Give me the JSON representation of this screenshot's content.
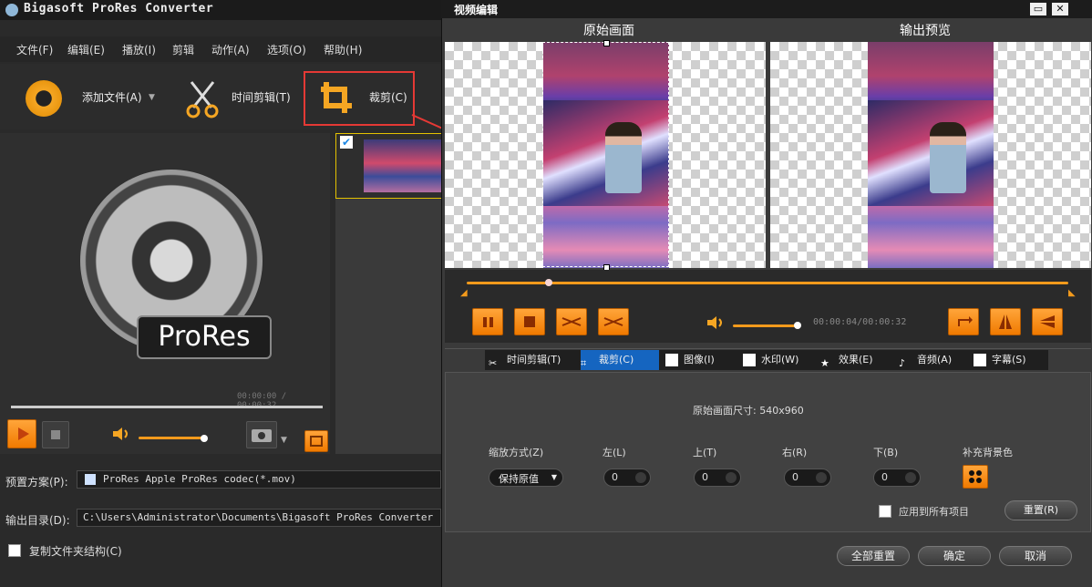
{
  "main_window": {
    "title": "Bigasoft ProRes Converter",
    "menu": [
      "文件(F)",
      "编辑(E)",
      "播放(I)",
      "剪辑",
      "动作(A)",
      "选项(O)",
      "帮助(H)"
    ],
    "toolbar": {
      "add_file": "添加文件(A)",
      "trim": "时间剪辑(T)",
      "crop": "裁剪(C)"
    },
    "logo_text": "ProRes",
    "player_time": "00:00:00 / 00:00:32",
    "preset_label": "预置方案(P):",
    "preset_value": "ProRes Apple ProRes codec(*.mov)",
    "output_label": "输出目录(D):",
    "output_value": "C:\\Users\\Administrator\\Documents\\Bigasoft ProRes Converter",
    "copy_structure_label": "复制文件夹结构(C)"
  },
  "dialog": {
    "title": "视频编辑",
    "original_label": "原始画面",
    "preview_label": "输出预览",
    "player_time": "00:00:04/00:00:32",
    "tabs": [
      "时间剪辑(T)",
      "裁剪(C)",
      "图像(I)",
      "水印(W)",
      "效果(E)",
      "音频(A)",
      "字幕(S)"
    ],
    "active_tab": "裁剪(C)",
    "original_size": "原始画面尺寸: 540x960",
    "zoom_label": "缩放方式(Z)",
    "zoom_value": "保持原值",
    "left_label": "左(L)",
    "left_value": "0",
    "top_label": "上(T)",
    "top_value": "0",
    "right_label": "右(R)",
    "right_value": "0",
    "bottom_label": "下(B)",
    "bottom_value": "0",
    "fill_bg_label": "补充背景色",
    "apply_all_label": "应用到所有项目",
    "reset_label": "重置(R)",
    "reset_all_label": "全部重置",
    "ok_label": "确定",
    "cancel_label": "取消"
  },
  "colors": {
    "accent": "#f29a1c",
    "highlight": "#e53935"
  }
}
